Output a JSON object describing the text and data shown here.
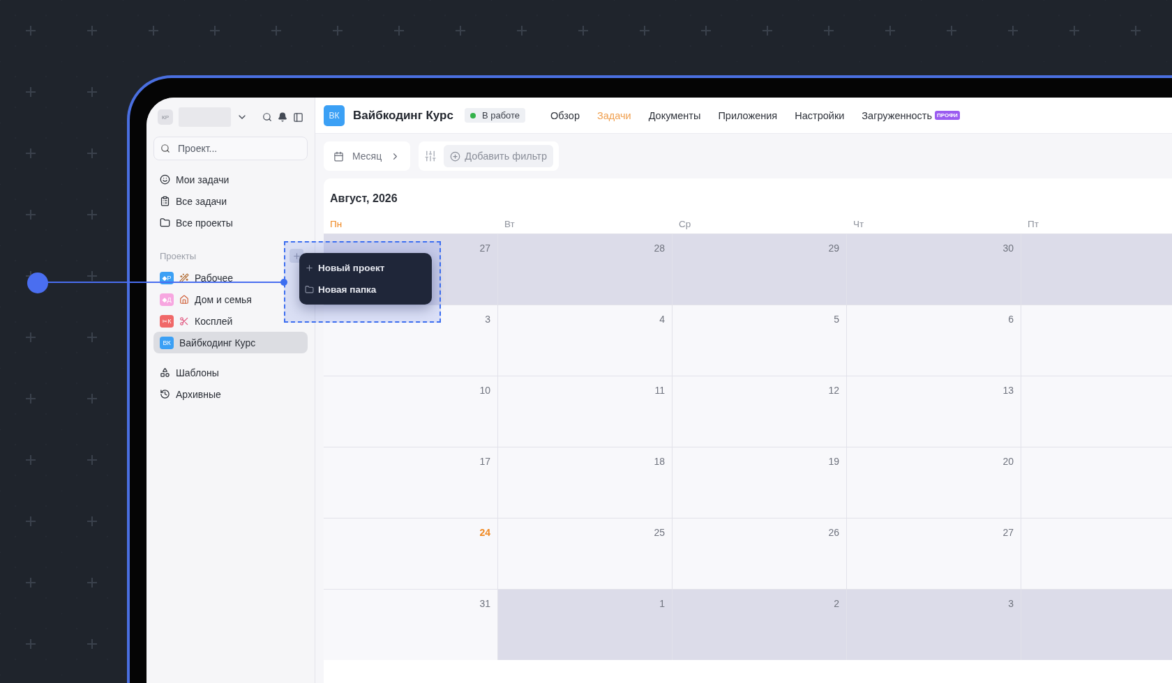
{
  "sidebar": {
    "avatar": "КР",
    "search": {
      "placeholder": "Проект..."
    },
    "nav": [
      {
        "label": "Мои задачи",
        "kind": "smile"
      },
      {
        "label": "Все задачи",
        "kind": "list"
      },
      {
        "label": "Все проекты",
        "kind": "folder"
      }
    ],
    "projects_title": "Проекты",
    "projects": [
      {
        "label": "Рабочее",
        "badge": "◆Р",
        "color": "#3ba0f5",
        "kind": "wand",
        "selected": false
      },
      {
        "label": "Дом и семья",
        "badge": "◆Д",
        "color": "#f7a6e0",
        "kind": "house",
        "selected": false
      },
      {
        "label": "Косплей",
        "badge": "✂К",
        "color": "#f06868",
        "kind": "scissors",
        "selected": false
      },
      {
        "label": "Вайбкодинг Курс",
        "badge": "ВК",
        "color": "#3ba0f5",
        "kind": "none",
        "selected": true
      }
    ],
    "footer": [
      {
        "label": "Шаблоны",
        "kind": "shapes"
      },
      {
        "label": "Архивные",
        "kind": "history"
      }
    ]
  },
  "menu": {
    "items": [
      {
        "label": "Новый проект",
        "kind": "add"
      },
      {
        "label": "Новая папка",
        "kind": "folder"
      }
    ]
  },
  "header": {
    "badge": "ВК",
    "title": "Вайбкодинг Курс",
    "status": {
      "label": "В работе",
      "color": "#34b24a"
    },
    "tabs": [
      {
        "label": "Обзор",
        "selected": false
      },
      {
        "label": "Задачи",
        "selected": true
      },
      {
        "label": "Документы",
        "selected": false
      },
      {
        "label": "Приложения",
        "selected": false
      },
      {
        "label": "Настройки",
        "selected": false
      },
      {
        "label": "Загруженность",
        "selected": false,
        "tag": "ПРОФИ"
      }
    ]
  },
  "toolbar": {
    "view": "Месяц",
    "filter": "Добавить фильтр"
  },
  "calendar": {
    "month": "Август, 2026",
    "weekdays": [
      {
        "label": "Пн",
        "selected": true
      },
      {
        "label": "Вт",
        "selected": false
      },
      {
        "label": "Ср",
        "selected": false
      },
      {
        "label": "Чт",
        "selected": false
      },
      {
        "label": "Пт",
        "selected": false
      }
    ],
    "weeks": [
      [
        {
          "day": "27",
          "muted": true,
          "selected": false
        },
        {
          "day": "28",
          "muted": true,
          "selected": false
        },
        {
          "day": "29",
          "muted": true,
          "selected": false
        },
        {
          "day": "30",
          "muted": true,
          "selected": false
        },
        {
          "muted": true
        }
      ],
      [
        {
          "day": "3",
          "muted": false,
          "selected": false
        },
        {
          "day": "4",
          "muted": false,
          "selected": false
        },
        {
          "day": "5",
          "muted": false,
          "selected": false
        },
        {
          "day": "6",
          "muted": false,
          "selected": false
        },
        {
          "muted": false
        }
      ],
      [
        {
          "day": "10",
          "muted": false,
          "selected": false
        },
        {
          "day": "11",
          "muted": false,
          "selected": false
        },
        {
          "day": "12",
          "muted": false,
          "selected": false
        },
        {
          "day": "13",
          "muted": false,
          "selected": false
        },
        {
          "muted": false
        }
      ],
      [
        {
          "day": "17",
          "muted": false,
          "selected": false
        },
        {
          "day": "18",
          "muted": false,
          "selected": false
        },
        {
          "day": "19",
          "muted": false,
          "selected": false
        },
        {
          "day": "20",
          "muted": false,
          "selected": false
        },
        {
          "muted": false
        }
      ],
      [
        {
          "day": "24",
          "muted": false,
          "selected": true
        },
        {
          "day": "25",
          "muted": false,
          "selected": false
        },
        {
          "day": "26",
          "muted": false,
          "selected": false
        },
        {
          "day": "27",
          "muted": false,
          "selected": false
        },
        {
          "muted": false
        }
      ],
      [
        {
          "day": "31",
          "muted": false,
          "selected": false
        },
        {
          "day": "1",
          "muted": true,
          "selected": false
        },
        {
          "day": "2",
          "muted": true,
          "selected": false
        },
        {
          "day": "3",
          "muted": true,
          "selected": false
        },
        {
          "muted": true
        }
      ]
    ]
  }
}
